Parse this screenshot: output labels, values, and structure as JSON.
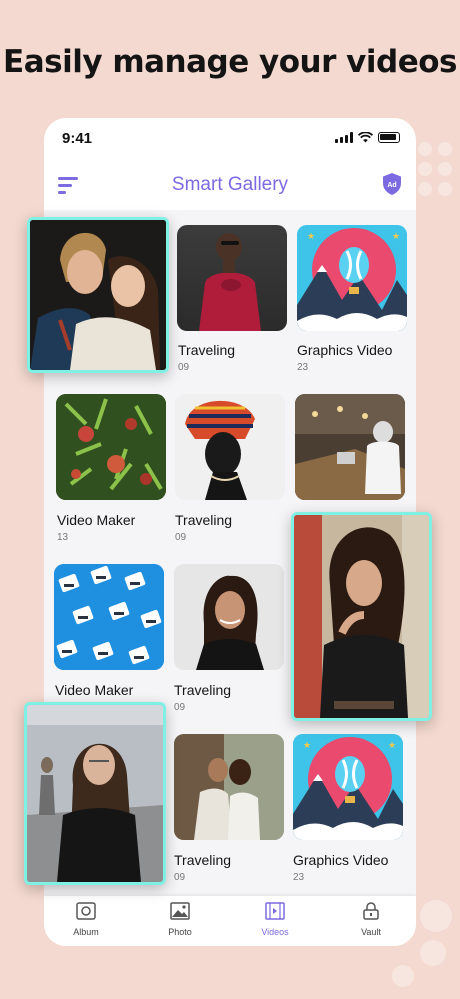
{
  "headline": "Easily manage your videos",
  "status_bar": {
    "time": "9:41"
  },
  "app": {
    "title": "Smart Gallery",
    "ad_badge": "Ad"
  },
  "grid": [
    {
      "title": "Traveling",
      "count": "09"
    },
    {
      "title": "Graphics Video",
      "count": "23"
    },
    {
      "title": "Video Maker",
      "count": "13"
    },
    {
      "title": "Traveling",
      "count": "09"
    },
    {
      "title": "Video Maker",
      "count": ""
    },
    {
      "title": "Traveling",
      "count": "09"
    },
    {
      "title": "Traveling",
      "count": "09"
    },
    {
      "title": "Graphics Video",
      "count": "23"
    }
  ],
  "tabs": [
    {
      "label": "Album",
      "icon": "album-icon"
    },
    {
      "label": "Photo",
      "icon": "photo-icon"
    },
    {
      "label": "Videos",
      "icon": "videos-icon"
    },
    {
      "label": "Vault",
      "icon": "vault-icon"
    }
  ],
  "colors": {
    "accent": "#7b6ae0",
    "highlight_border": "#7ff0e4",
    "background": "#f3d9cf"
  }
}
